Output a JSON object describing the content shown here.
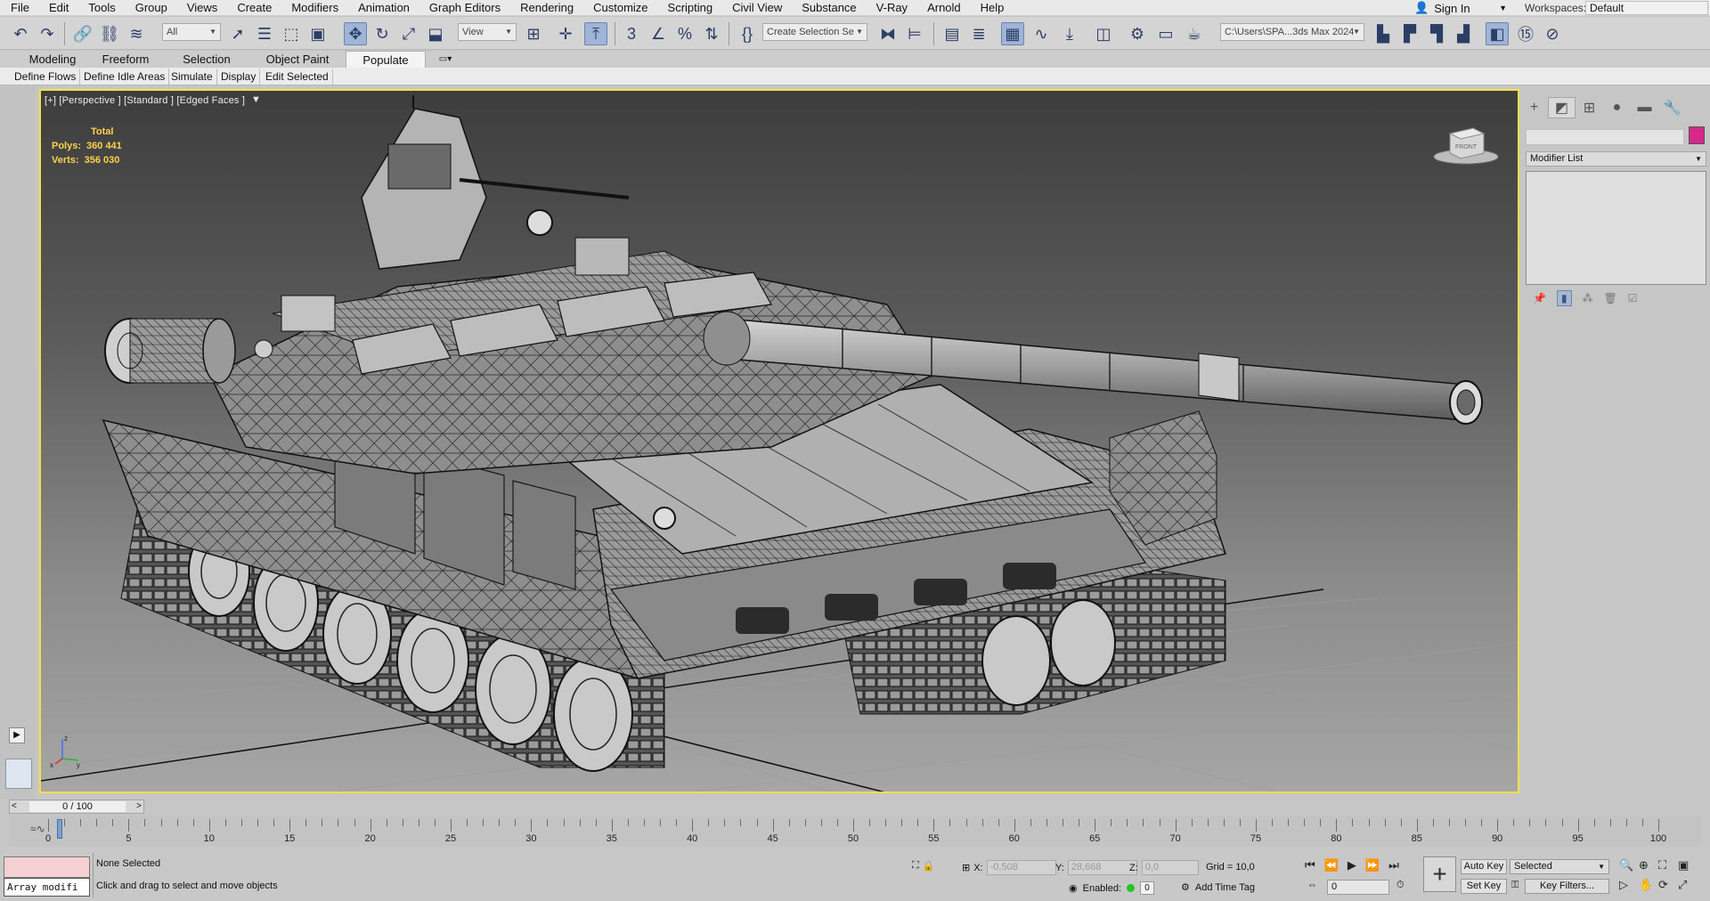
{
  "menu": [
    "File",
    "Edit",
    "Tools",
    "Group",
    "Views",
    "Create",
    "Modifiers",
    "Animation",
    "Graph Editors",
    "Rendering",
    "Customize",
    "Scripting",
    "Civil View",
    "Substance",
    "V-Ray",
    "Arnold",
    "Help"
  ],
  "account": {
    "sign_in": "Sign In",
    "workspaces_label": "Workspaces:",
    "workspace": "Default"
  },
  "toolbar": {
    "filter_select": "All",
    "ref_coord": "View",
    "named_selection": "Create Selection Se",
    "project_path": "C:\\Users\\SPA...3ds Max 2024"
  },
  "ribbon_tabs": [
    {
      "label": "Modeling",
      "active": false
    },
    {
      "label": "Freeform",
      "active": false
    },
    {
      "label": "Selection",
      "active": false
    },
    {
      "label": "Object Paint",
      "active": false
    },
    {
      "label": "Populate",
      "active": true
    }
  ],
  "populate_buttons": [
    "Define Flows",
    "Define Idle Areas",
    "Simulate",
    "Display",
    "Edit Selected"
  ],
  "viewport": {
    "label": "[+] [Perspective ] [Standard ] [Edged Faces ]",
    "stats": {
      "total_label": "Total",
      "polys_label": "Polys:",
      "polys": "360 441",
      "verts_label": "Verts:",
      "verts": "356 030"
    },
    "viewcube_face": "FRONT"
  },
  "command_panel": {
    "modifier_list": "Modifier List",
    "object_color": "#d6298a"
  },
  "timeline": {
    "frame_display": "0 / 100",
    "ticks": [
      "0",
      "5",
      "10",
      "15",
      "20",
      "25",
      "30",
      "35",
      "40",
      "45",
      "50",
      "55",
      "60",
      "65",
      "70",
      "75",
      "80",
      "85",
      "90",
      "95",
      "100"
    ]
  },
  "status": {
    "maxscript_input": "Array modifi",
    "selection": "None Selected",
    "prompt": "Click and drag to select and move objects",
    "x_label": "X:",
    "x_value": "-0,508",
    "y_label": "Y:",
    "y_value": "28,668",
    "z_label": "Z:",
    "z_value": "0,0",
    "grid": "Grid = 10,0",
    "enabled_label": "Enabled:",
    "enabled_value": "0",
    "add_time_tag": "Add Time Tag",
    "current_frame": "0",
    "auto_key": "Auto Key",
    "set_key": "Set Key",
    "key_mode": "Selected",
    "key_filters": "Key Filters..."
  }
}
